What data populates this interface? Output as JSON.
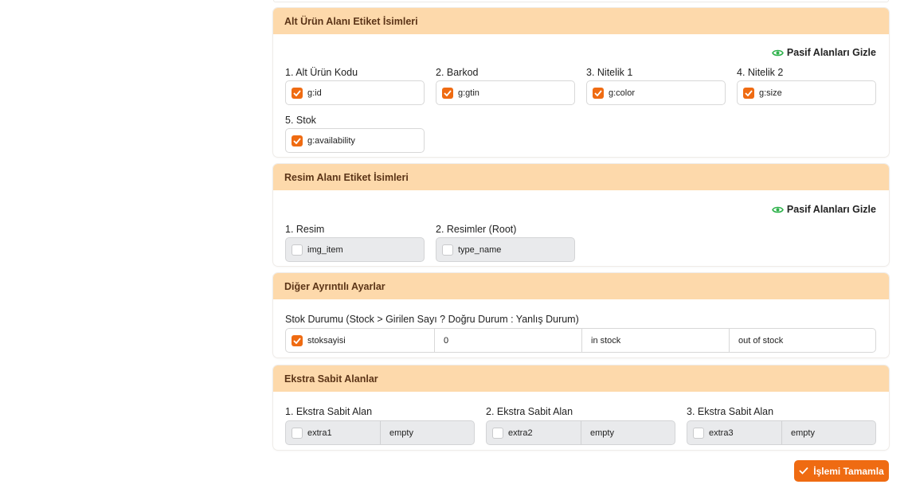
{
  "sections": {
    "alt_urun": {
      "title": "Alt Ürün Alanı Etiket İsimleri",
      "toggle_label": "Pasif Alanları Gizle",
      "fields": [
        {
          "label": "1. Alt Ürün Kodu",
          "value": "g:id",
          "checked": true
        },
        {
          "label": "2. Barkod",
          "value": "g:gtin",
          "checked": true
        },
        {
          "label": "3. Nitelik 1",
          "value": "g:color",
          "checked": true
        },
        {
          "label": "4. Nitelik 2",
          "value": "g:size",
          "checked": true
        },
        {
          "label": "5. Stok",
          "value": "g:availability",
          "checked": true
        }
      ]
    },
    "resim": {
      "title": "Resim Alanı Etiket İsimleri",
      "toggle_label": "Pasif Alanları Gizle",
      "fields": [
        {
          "label": "1. Resim",
          "value": "img_item",
          "checked": false
        },
        {
          "label": "2. Resimler (Root)",
          "value": "type_name",
          "checked": false
        }
      ]
    },
    "diger": {
      "title": "Diğer Ayrıntılı Ayarlar",
      "stock_label": "Stok Durumu (Stock > Girilen Sayı ? Doğru Durum : Yanlış Durum)",
      "stock_field": "stoksayisi",
      "stock_checked": true,
      "threshold": "0",
      "true_state": "in stock",
      "false_state": "out of stock"
    },
    "ekstra": {
      "title": "Ekstra Sabit Alanlar",
      "fields": [
        {
          "label": "1. Ekstra Sabit Alan",
          "name": "extra1",
          "value": "empty",
          "checked": false
        },
        {
          "label": "2. Ekstra Sabit Alan",
          "name": "extra2",
          "value": "empty",
          "checked": false
        },
        {
          "label": "3. Ekstra Sabit Alan",
          "name": "extra3",
          "value": "empty",
          "checked": false
        }
      ]
    }
  },
  "submit_label": "İşlemi Tamamla",
  "colors": {
    "accent": "#ef6b12",
    "header_bg": "#fdd9ab",
    "header_text": "#5b3417",
    "eye_icon": "#2fb24c"
  }
}
